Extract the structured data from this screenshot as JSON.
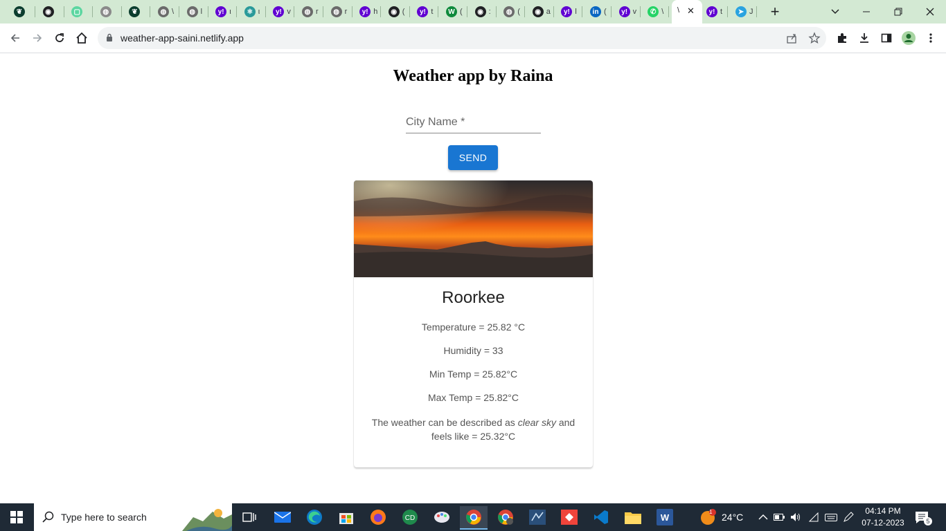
{
  "browser": {
    "tabs": [
      {
        "icon": "leaf-icon",
        "color": "#0b3d2e",
        "ch": ""
      },
      {
        "icon": "github-icon",
        "color": "#202124",
        "ch": ""
      },
      {
        "icon": "outline-square-icon",
        "color": "#5bd6a0",
        "ch": ""
      },
      {
        "icon": "globe-icon",
        "color": "#8a8a8a",
        "ch": ""
      },
      {
        "icon": "leaf-icon",
        "color": "#0b3d2e",
        "ch": ""
      },
      {
        "icon": "globe-icon",
        "color": "#6b6b6b",
        "ch": "\\"
      },
      {
        "icon": "globe-icon",
        "color": "#6b6b6b",
        "ch": "l"
      },
      {
        "icon": "yahoo-icon",
        "color": "#6001d2",
        "ch": "ι"
      },
      {
        "icon": "react-icon",
        "color": "#2a9a9a",
        "ch": "ι"
      },
      {
        "icon": "yahoo-icon",
        "color": "#6001d2",
        "ch": "v"
      },
      {
        "icon": "globe-icon",
        "color": "#6b6b6b",
        "ch": "r"
      },
      {
        "icon": "globe-icon",
        "color": "#6b6b6b",
        "ch": "r"
      },
      {
        "icon": "yahoo-icon",
        "color": "#6001d2",
        "ch": "h"
      },
      {
        "icon": "github-icon",
        "color": "#202124",
        "ch": "("
      },
      {
        "icon": "yahoo-icon",
        "color": "#6001d2",
        "ch": "t"
      },
      {
        "icon": "w-icon",
        "color": "#0f8a3c",
        "ch": "("
      },
      {
        "icon": "github-icon",
        "color": "#202124",
        "ch": ":"
      },
      {
        "icon": "globe-icon",
        "color": "#6b6b6b",
        "ch": "("
      },
      {
        "icon": "github-icon",
        "color": "#202124",
        "ch": "a"
      },
      {
        "icon": "yahoo-icon",
        "color": "#6001d2",
        "ch": "l"
      },
      {
        "icon": "linkedin-icon",
        "color": "#0a66c2",
        "ch": "("
      },
      {
        "icon": "yahoo-icon",
        "color": "#6001d2",
        "ch": "v"
      },
      {
        "icon": "whatsapp-icon",
        "color": "#25d366",
        "ch": "\\"
      }
    ],
    "active_tab": {
      "ch": "\\",
      "close": "✕"
    },
    "after_tabs": [
      {
        "icon": "yahoo-icon",
        "color": "#6001d2",
        "ch": "t"
      },
      {
        "icon": "telegram-icon",
        "color": "#2aa3e0",
        "ch": "J"
      }
    ],
    "new_tab": "+",
    "url": "weather-app-saini.netlify.app"
  },
  "page": {
    "title": "Weather app by Raina",
    "city_placeholder": "City Name *",
    "send_label": "SEND",
    "city": "Roorkee",
    "temperature": "Temperature = 25.82 °C",
    "humidity": "Humidity = 33",
    "min_temp": "Min Temp = 25.82°C",
    "max_temp": "Max Temp = 25.82°C",
    "desc_prefix": "The weather can be described as ",
    "desc_value": "clear sky",
    "desc_suffix": " and feels like = 25.32°C"
  },
  "taskbar": {
    "search_placeholder": "Type here to search",
    "weather": "24°C",
    "weather_badge": "1",
    "time": "04:14 PM",
    "date": "07-12-2023",
    "notification_count": "5"
  }
}
